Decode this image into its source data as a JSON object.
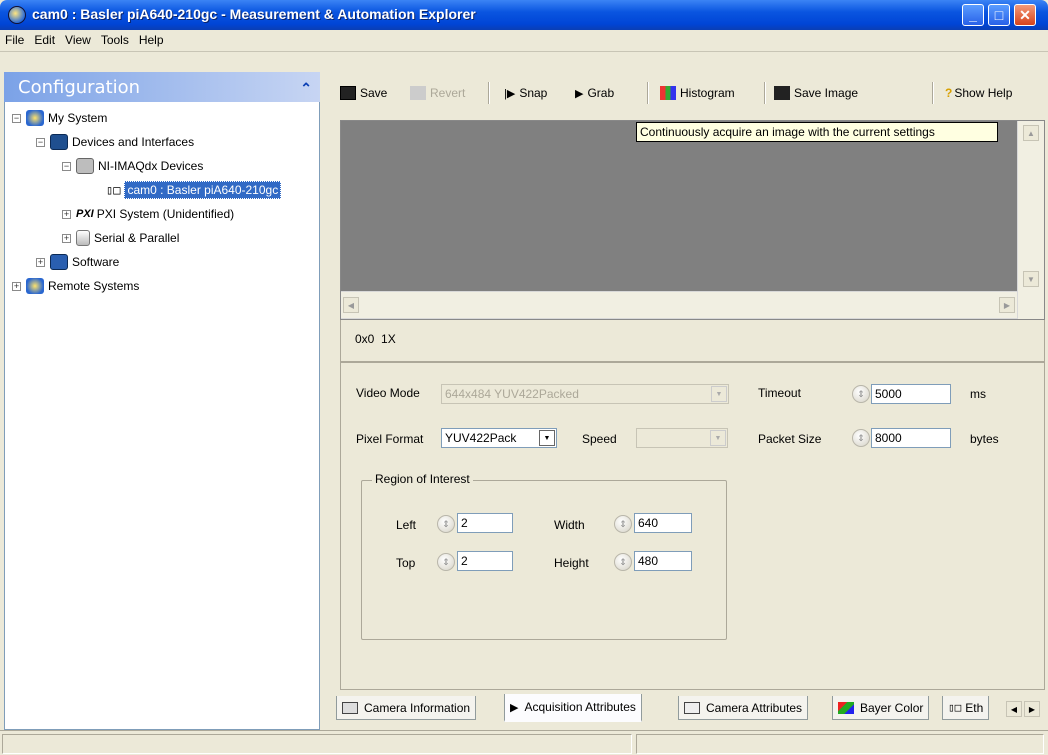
{
  "window": {
    "title": "cam0 : Basler piA640-210gc - Measurement & Automation Explorer"
  },
  "menu": [
    "File",
    "Edit",
    "View",
    "Tools",
    "Help"
  ],
  "config": {
    "title": "Configuration"
  },
  "tree": {
    "my_system": "My System",
    "devices": "Devices and Interfaces",
    "imaqdx": "NI-IMAQdx Devices",
    "cam": "cam0 : Basler piA640-210gc",
    "pxi": "PXI System (Unidentified)",
    "serial": "Serial & Parallel",
    "software": "Software",
    "remote": "Remote Systems"
  },
  "toolbar": {
    "save": "Save",
    "revert": "Revert",
    "snap": "Snap",
    "grab": "Grab",
    "histogram": "Histogram",
    "save_image": "Save Image",
    "show_help": "Show Help"
  },
  "tooltip": "Continuously acquire an image with the current settings",
  "status": {
    "coords": "0x0",
    "zoom": "1X"
  },
  "settings": {
    "video_mode_label": "Video Mode",
    "video_mode_value": "644x484 YUV422Packed",
    "pixel_format_label": "Pixel Format",
    "pixel_format_value": "YUV422Pack",
    "speed_label": "Speed",
    "speed_value": "",
    "timeout_label": "Timeout",
    "timeout_value": "5000",
    "timeout_unit": "ms",
    "packet_label": "Packet Size",
    "packet_value": "8000",
    "packet_unit": "bytes",
    "roi_title": "Region of Interest",
    "left_label": "Left",
    "left_value": "2",
    "top_label": "Top",
    "top_value": "2",
    "width_label": "Width",
    "width_value": "640",
    "height_label": "Height",
    "height_value": "480"
  },
  "tabs": {
    "camera_info": "Camera Information",
    "acq": "Acquisition Attributes",
    "cam_attr": "Camera Attributes",
    "bayer": "Bayer Color",
    "eth": "Eth"
  }
}
